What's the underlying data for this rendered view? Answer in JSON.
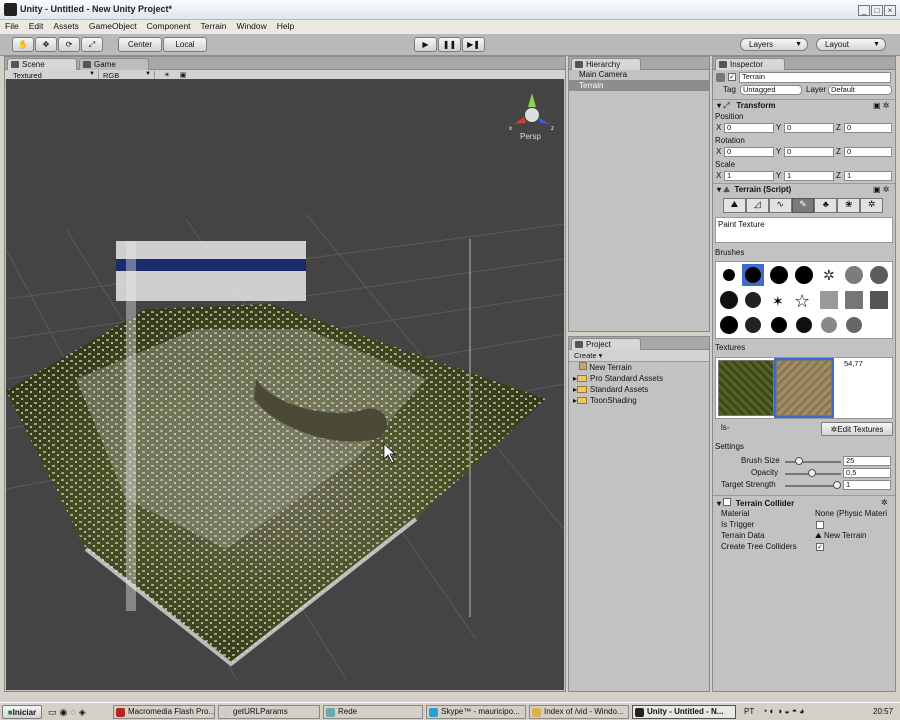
{
  "window": {
    "title": "Unity - Untitled - New Unity Project*",
    "controls": [
      "_",
      "□",
      "×"
    ]
  },
  "menu": [
    "File",
    "Edit",
    "Assets",
    "GameObject",
    "Component",
    "Terrain",
    "Window",
    "Help"
  ],
  "toolbar": {
    "center": "Center",
    "local": "Local",
    "layers": "Layers",
    "layout": "Layout"
  },
  "scene": {
    "tab_scene": "Scene",
    "tab_game": "Game",
    "render_mode": "Textured",
    "color_mode": "RGB",
    "persp": "Persp"
  },
  "hierarchy": {
    "title": "Hierarchy",
    "items": [
      "Main Camera",
      "Terrain"
    ]
  },
  "project": {
    "title": "Project",
    "create": "Create",
    "items": [
      "New Terrain",
      "Pro Standard Assets",
      "Standard Assets",
      "ToonShading"
    ]
  },
  "inspector": {
    "title": "Inspector",
    "object_name": "Terrain",
    "tag_label": "Tag",
    "tag_value": "Untagged",
    "layer_label": "Layer",
    "layer_value": "Default",
    "transform": {
      "title": "Transform",
      "position": "Position",
      "rotation": "Rotation",
      "scale": "Scale",
      "pos": {
        "x": "0",
        "y": "0",
        "z": "0"
      },
      "rot": {
        "x": "0",
        "y": "0",
        "z": "0"
      },
      "scl": {
        "x": "1",
        "y": "1",
        "z": "1"
      },
      "x": "X",
      "y": "Y",
      "z": "Z"
    },
    "terrain_script": "Terrain (Script)",
    "paint_texture": "Paint Texture",
    "brushes": "Brushes",
    "textures": "Textures",
    "texture_value": "54,77",
    "ls": "ls-",
    "edit_textures": "Edit Textures",
    "settings": "Settings",
    "brush_size_label": "Brush Size",
    "brush_size": "25",
    "opacity_label": "Opacity",
    "opacity": "0,5",
    "target_strength_label": "Target Strength",
    "target_strength": "1",
    "collider": {
      "title": "Terrain Collider",
      "material_label": "Material",
      "material_value": "None (Physic Materi",
      "trigger_label": "Is Trigger",
      "data_label": "Terrain Data",
      "data_value": "New Terrain",
      "tree_label": "Create Tree Colliders"
    }
  },
  "taskbar": {
    "start": "Iniciar",
    "tasks": [
      "Macromedia Flash Pro...",
      "getURLParams",
      "Rede",
      "Skype™ - mauricipo...",
      "Index of /vid - Windo...",
      "Unity - Untitled - N..."
    ],
    "lang": "PT",
    "clock": "20:57"
  }
}
